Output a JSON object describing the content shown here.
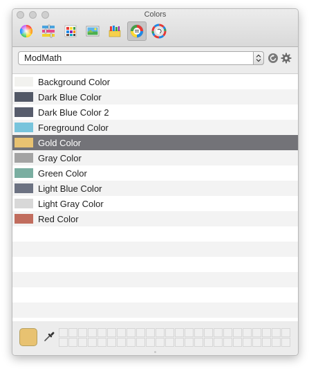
{
  "window": {
    "title": "Colors"
  },
  "toolbar": {
    "modes": [
      {
        "name": "color-wheel-tab",
        "icon": "color-wheel-icon",
        "active": false
      },
      {
        "name": "color-sliders-tab",
        "icon": "sliders-icon",
        "active": false
      },
      {
        "name": "color-palettes-tab",
        "icon": "palette-grid-icon",
        "active": false
      },
      {
        "name": "image-palettes-tab",
        "icon": "image-palette-icon",
        "active": false
      },
      {
        "name": "pencils-tab",
        "icon": "crayons-icon",
        "active": false
      },
      {
        "name": "color-list-tab",
        "icon": "color-list-icon",
        "active": true
      },
      {
        "name": "third-party-picker-tab",
        "icon": "picker-plugin-icon",
        "active": false
      }
    ]
  },
  "palette": {
    "selected": "ModMath"
  },
  "colors": [
    {
      "label": "Background Color",
      "hex": "#f2f2ef"
    },
    {
      "label": "Dark Blue Color",
      "hex": "#525866"
    },
    {
      "label": "Dark Blue Color 2",
      "hex": "#585d6d"
    },
    {
      "label": "Foreground Color",
      "hex": "#78c4dc"
    },
    {
      "label": "Gold Color",
      "hex": "#e8c271",
      "selected": true
    },
    {
      "label": "Gray Color",
      "hex": "#a3a3a3"
    },
    {
      "label": "Green Color",
      "hex": "#7aaea1"
    },
    {
      "label": "Light Blue Color",
      "hex": "#6c7282"
    },
    {
      "label": "Light Gray Color",
      "hex": "#d8d8d8"
    },
    {
      "label": "Red Color",
      "hex": "#c16d5e"
    }
  ],
  "current_color": "#e8c271",
  "selection_color": "#737378"
}
